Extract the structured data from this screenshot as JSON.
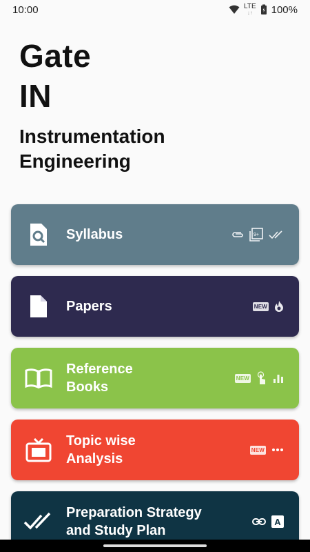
{
  "status_bar": {
    "time": "10:00",
    "network": "LTE",
    "battery": "100%"
  },
  "header": {
    "line1": "Gate",
    "line2": "IN",
    "subtitle_line1": "Instrumentation",
    "subtitle_line2": "Engineering"
  },
  "cards": [
    {
      "label": "Syllabus",
      "color": "#607d8b",
      "icon": "magnifier-document-icon",
      "trail": [
        "paperclip-icon",
        "filter-9-plus-icon",
        "double-check-icon"
      ]
    },
    {
      "label": "Papers",
      "color": "#2e2a4f",
      "icon": "document-icon",
      "badge": "NEW",
      "trail": [
        "fire-icon"
      ]
    },
    {
      "label": "Reference\nBooks",
      "color": "#8bc34a",
      "icon": "open-book-icon",
      "badge": "NEW",
      "trail": [
        "touch-icon",
        "bar-chart-icon"
      ]
    },
    {
      "label": "Topic wise\nAnalysis",
      "color": "#f04632",
      "icon": "tv-icon",
      "badge": "NEW",
      "trail": [
        "more-horizontal-icon"
      ]
    },
    {
      "label": "Preparation Strategy\nand Study Plan",
      "color": "#0f3444",
      "icon": "double-check-icon",
      "trail": [
        "link-icon",
        "letter-a-icon"
      ]
    }
  ],
  "badge_text": "NEW",
  "letter_a": "A"
}
